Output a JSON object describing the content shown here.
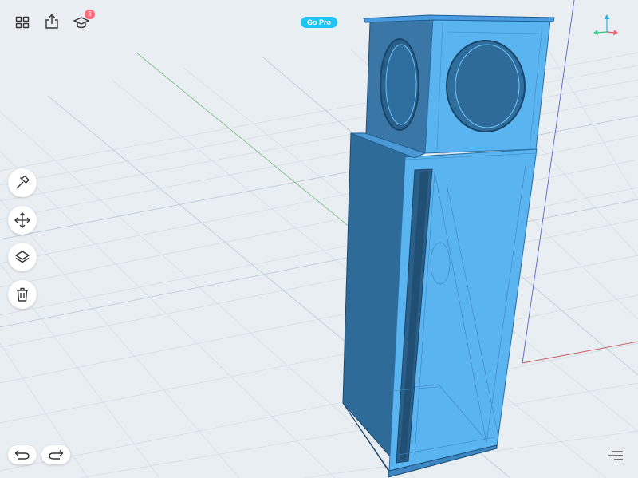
{
  "toolbar": {
    "notification_count": "3",
    "go_pro_label": "Go Pro"
  },
  "icons": {
    "grid": "grid-icon",
    "share": "share-icon",
    "learn": "graduation-cap-icon",
    "axes": "axes-gizmo-icon",
    "hammer": "hammer-icon",
    "move": "move-arrows-icon",
    "layers": "layers-icon",
    "trash": "trash-icon",
    "undo": "undo-icon",
    "redo": "redo-icon",
    "menu": "menu-lines-icon"
  },
  "colors": {
    "accent": "#1ec4f3",
    "badge": "#ff6b7a",
    "model_light": "#5ab4f0",
    "model_dark": "#2f6b98",
    "background": "#e9eef3"
  }
}
